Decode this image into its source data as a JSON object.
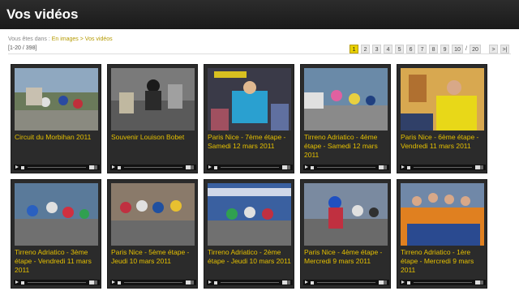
{
  "header": {
    "title": "Vos vidéos"
  },
  "breadcrumb": {
    "prefix": "Vous êtes dans :",
    "link": "En images",
    "sep": ">",
    "current": "Vos vidéos"
  },
  "count": "[1-20 / 398]",
  "pager": {
    "pages": [
      "1",
      "2",
      "3",
      "4",
      "5",
      "6",
      "7",
      "8",
      "9",
      "10"
    ],
    "sep": "/",
    "total": "20",
    "next": ">",
    "last": ">|"
  },
  "videos": [
    {
      "title": "Circuit du Morbihan 2011"
    },
    {
      "title": "Souvenir Louison Bobet"
    },
    {
      "title": "Paris Nice - 7ème étape - Samedi 12 mars 2011"
    },
    {
      "title": "Tirreno Adriatico - 4ème étape - Samedi 12 mars 2011"
    },
    {
      "title": "Paris Nice - 6ème étape - Vendredi 11 mars 2011"
    },
    {
      "title": "Tirreno Adriatico - 3ème étape - Vendredi 11 mars 2011"
    },
    {
      "title": "Paris Nice - 5ème étape - Jeudi 10 mars 2011"
    },
    {
      "title": "Tirreno Adriatico - 2ème étape - Jeudi 10 mars 2011"
    },
    {
      "title": "Paris Nice - 4ème étape - Mercredi 9 mars 2011"
    },
    {
      "title": "Tirreno Adriatico - 1ère étape - Mercredi 9 mars 2011"
    }
  ]
}
